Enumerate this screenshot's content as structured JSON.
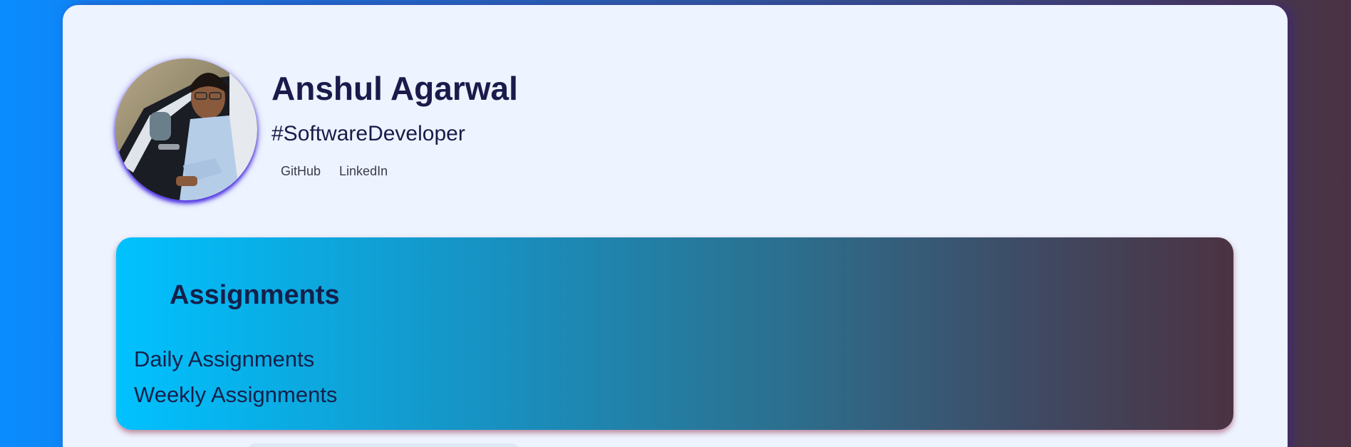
{
  "profile": {
    "name": "Anshul Agarwal",
    "tagline": "#SoftwareDeveloper",
    "links": [
      {
        "label": "GitHub"
      },
      {
        "label": "LinkedIn"
      }
    ]
  },
  "assignments": {
    "title": "Assignments",
    "items": [
      {
        "label": "Daily Assignments"
      },
      {
        "label": "Weekly Assignments"
      }
    ]
  },
  "colors": {
    "card_background": "#edf3ff",
    "text_dark": "#1b1a4a",
    "gradient_start": "#00c2ff",
    "gradient_end": "#4b3342"
  }
}
